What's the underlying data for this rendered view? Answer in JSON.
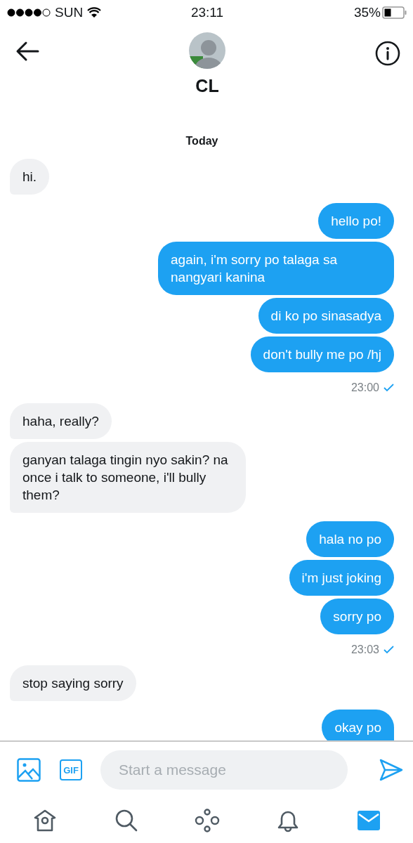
{
  "status_bar": {
    "carrier": "SUN",
    "time": "23:11",
    "battery": "35%"
  },
  "header": {
    "name": "CL"
  },
  "date_divider": "Today",
  "groups": [
    {
      "kind": "received",
      "bubbles": [
        "hi."
      ]
    },
    {
      "kind": "sent",
      "bubbles": [
        "hello po!",
        "again, i'm sorry po talaga sa nangyari kanina",
        "di ko po sinasadya",
        "don't bully me po /hj"
      ],
      "time": "23:00"
    },
    {
      "kind": "received",
      "bubbles": [
        "haha, really?",
        "ganyan talaga tingin nyo sakin? na once i talk to someone, i'll bully them?"
      ]
    },
    {
      "kind": "sent",
      "bubbles": [
        "hala no po",
        "i'm just joking",
        "sorry po"
      ],
      "time": "23:03"
    },
    {
      "kind": "received",
      "bubbles": [
        "stop saying sorry"
      ]
    },
    {
      "kind": "sent",
      "bubbles": [
        "okay po"
      ]
    }
  ],
  "composer": {
    "placeholder": "Start a message",
    "gif_label": "GIF"
  },
  "tab_bar": [
    {
      "kind": "home",
      "selected": false
    },
    {
      "kind": "search",
      "selected": false
    },
    {
      "kind": "spaces",
      "selected": false
    },
    {
      "kind": "notifications",
      "selected": false
    },
    {
      "kind": "messages",
      "selected": true
    }
  ]
}
